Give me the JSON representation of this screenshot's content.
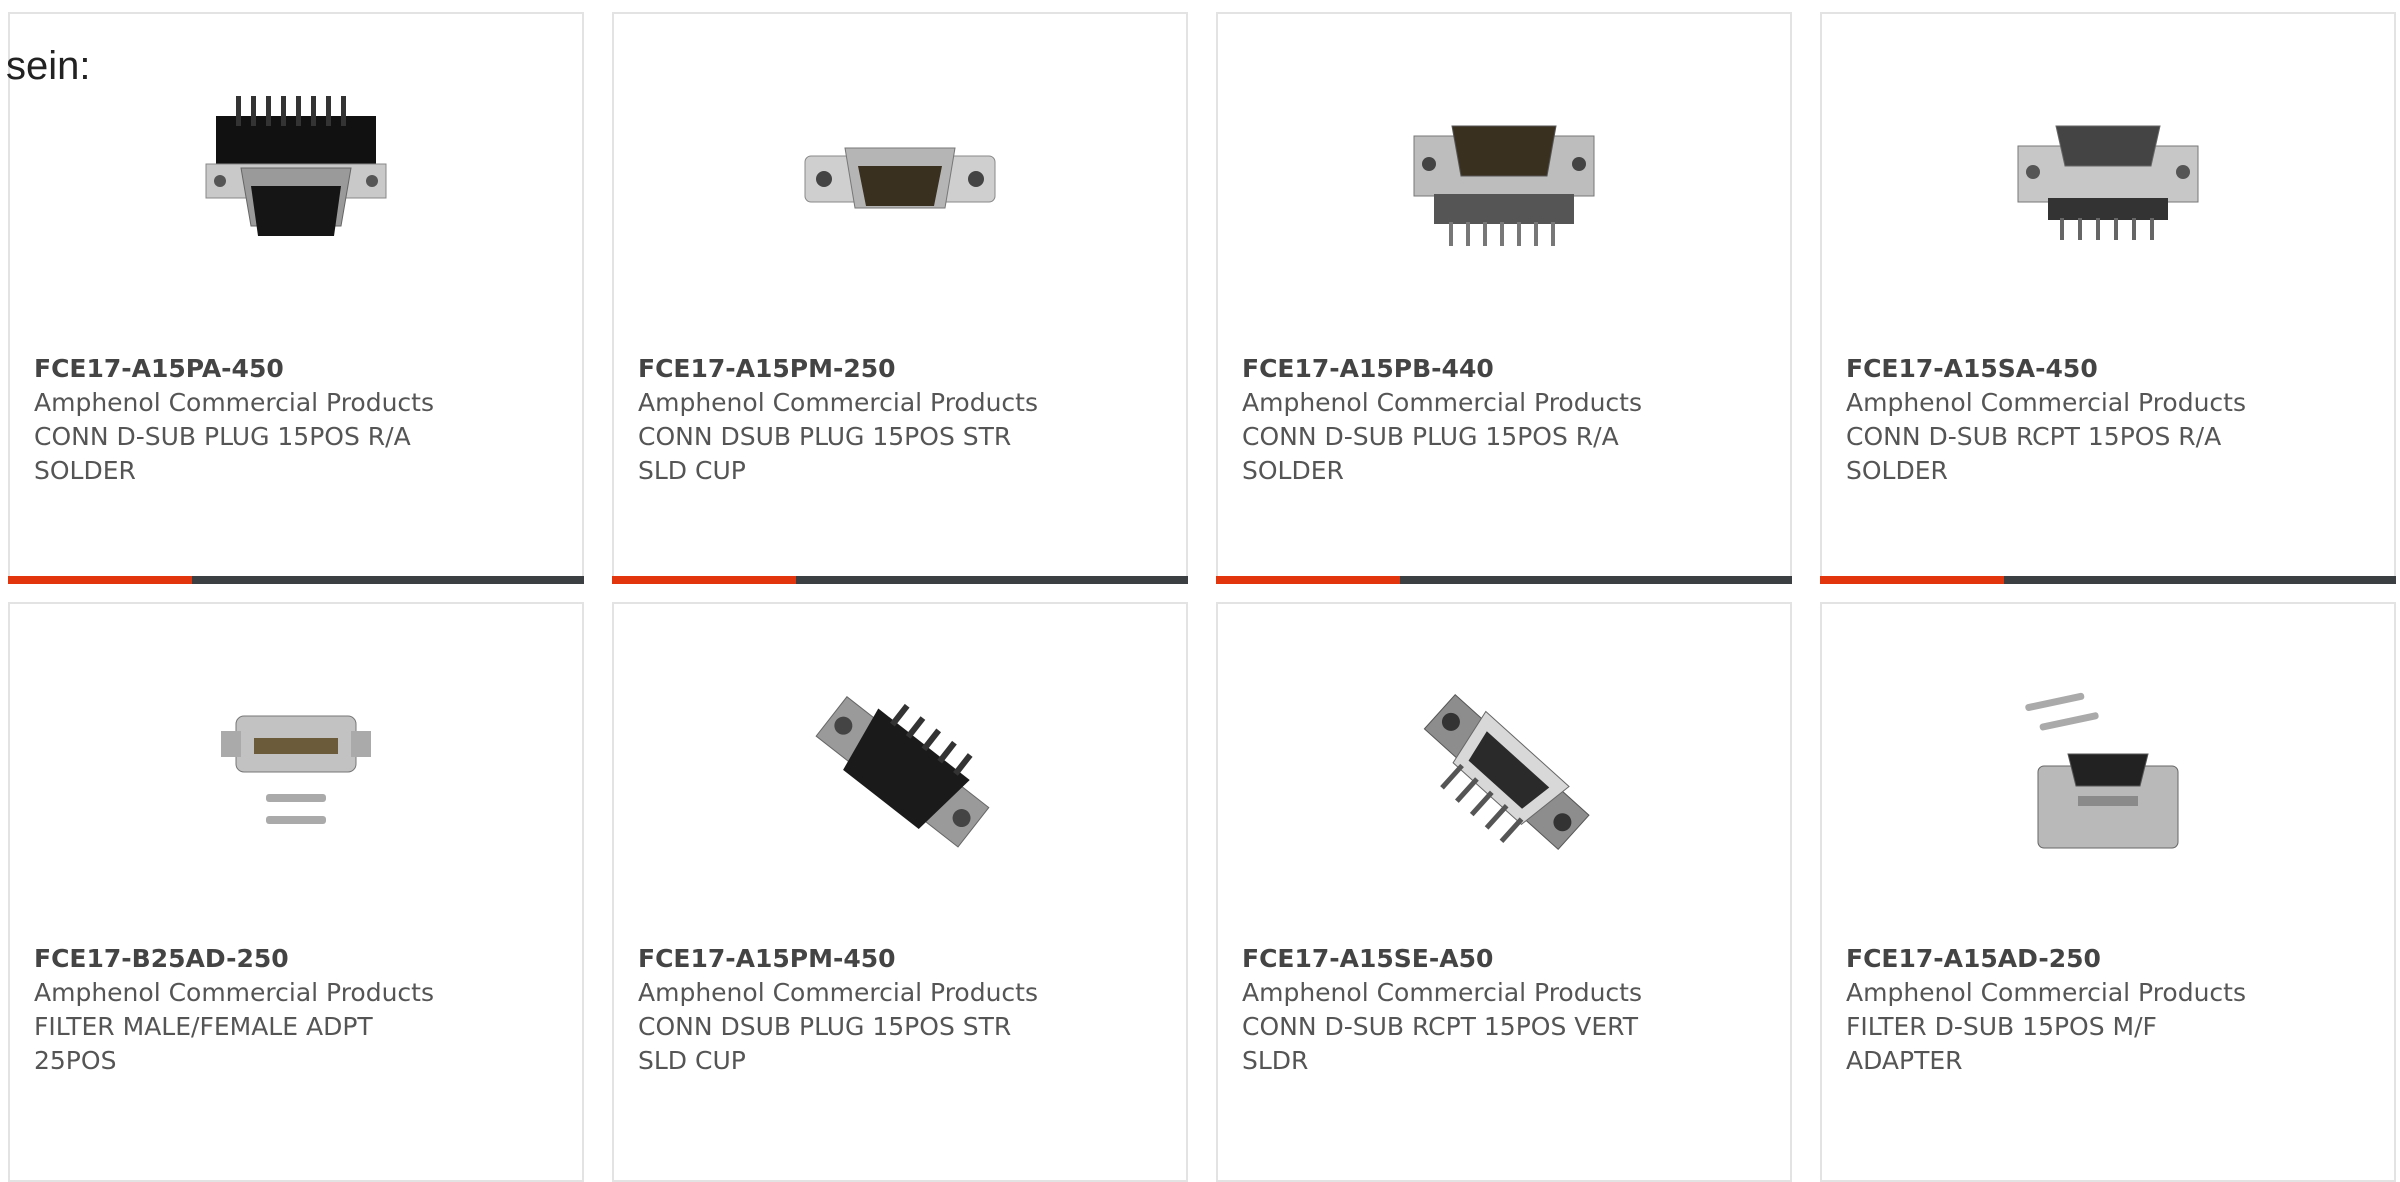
{
  "intro_text": "sein:",
  "colors": {
    "accent": "#e3350d",
    "bar": "#3c3f41",
    "border": "#e3e3e3"
  },
  "products": [
    {
      "mpn": "FCE17-A15PA-450",
      "manufacturer": "Amphenol Commercial Products",
      "description": "CONN D-SUB PLUG 15POS R/A SOLDER",
      "image_icon": "dsub-plug-right-angle-icon"
    },
    {
      "mpn": "FCE17-A15PM-250",
      "manufacturer": "Amphenol Commercial Products",
      "description": "CONN DSUB PLUG 15POS STR SLD CUP",
      "image_icon": "dsub-plug-straight-icon"
    },
    {
      "mpn": "FCE17-A15PB-440",
      "manufacturer": "Amphenol Commercial Products",
      "description": "CONN D-SUB PLUG 15POS R/A SOLDER",
      "image_icon": "dsub-plug-right-angle-icon"
    },
    {
      "mpn": "FCE17-A15SA-450",
      "manufacturer": "Amphenol Commercial Products",
      "description": "CONN D-SUB RCPT 15POS R/A SOLDER",
      "image_icon": "dsub-receptacle-right-angle-icon"
    },
    {
      "mpn": "FCE17-B25AD-250",
      "manufacturer": "Amphenol Commercial Products",
      "description": "FILTER MALE/FEMALE ADPT 25POS",
      "image_icon": "dsub-adapter-with-screws-icon"
    },
    {
      "mpn": "FCE17-A15PM-450",
      "manufacturer": "Amphenol Commercial Products",
      "description": "CONN DSUB PLUG 15POS STR SLD CUP",
      "image_icon": "dsub-plug-angled-icon"
    },
    {
      "mpn": "FCE17-A15SE-A50",
      "manufacturer": "Amphenol Commercial Products",
      "description": "CONN D-SUB RCPT 15POS VERT SLDR",
      "image_icon": "dsub-receptacle-vertical-icon"
    },
    {
      "mpn": "FCE17-A15AD-250",
      "manufacturer": "Amphenol Commercial Products",
      "description": "FILTER D-SUB 15POS M/F ADAPTER",
      "image_icon": "dsub-adapter-with-screws-icon"
    }
  ]
}
